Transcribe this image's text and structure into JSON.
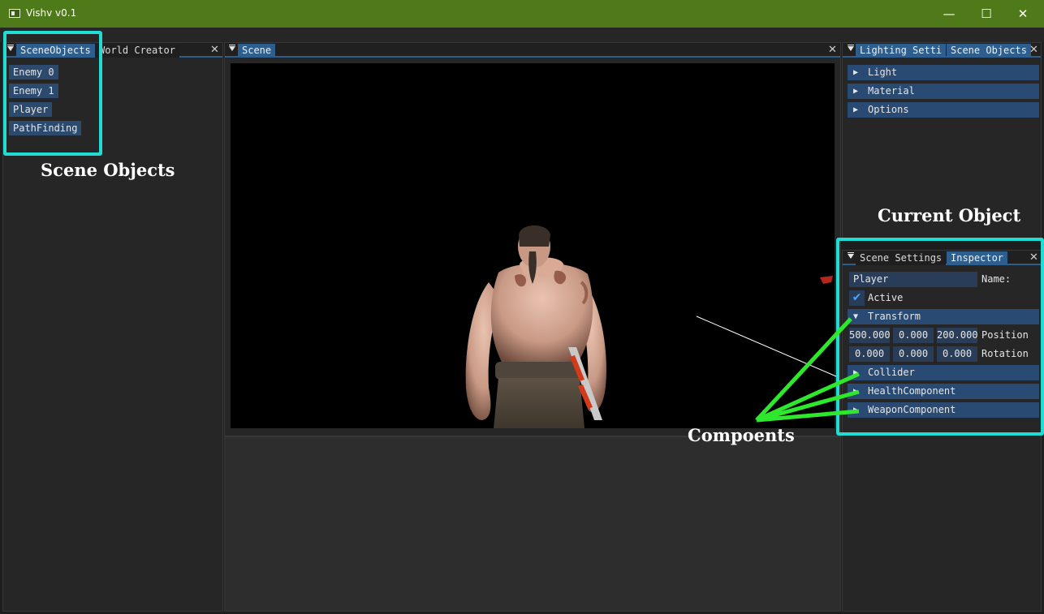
{
  "window": {
    "title": "Vishv v0.1",
    "minimize": "—",
    "maximize": "☐",
    "close": "✕"
  },
  "scene_objects_panel": {
    "tabs": [
      "SceneObjects",
      "World Creator"
    ],
    "items": [
      "Enemy 0",
      "Enemy 1",
      "Player",
      "PathFinding"
    ]
  },
  "scene_panel": {
    "tab": "Scene"
  },
  "lighting_panel": {
    "tabs": [
      "Lighting Setti",
      "Scene Objects"
    ],
    "headers": [
      "Light",
      "Material",
      "Options"
    ]
  },
  "inspector_panel": {
    "tabs": [
      "Scene Settings",
      "Inspector"
    ],
    "name_value": "Player",
    "name_label": "Name:",
    "active_label": "Active",
    "active_checked": true,
    "transform_label": "Transform",
    "position": {
      "values": [
        "500.000",
        "0.000",
        "200.000"
      ],
      "label": "Position"
    },
    "rotation": {
      "values": [
        "0.000",
        "0.000",
        "0.000"
      ],
      "label": "Rotation"
    },
    "components": [
      "Collider",
      "HealthComponent",
      "WeaponComponent"
    ]
  },
  "annotations": {
    "scene_objects": "Scene Objects",
    "current_object": "Current Object",
    "components": "Compoents"
  },
  "colors": {
    "titlebar": "#4e7a1a",
    "accent": "#2d5e8e",
    "highlight": "#22dcd4",
    "arrow": "#2ee82e"
  }
}
